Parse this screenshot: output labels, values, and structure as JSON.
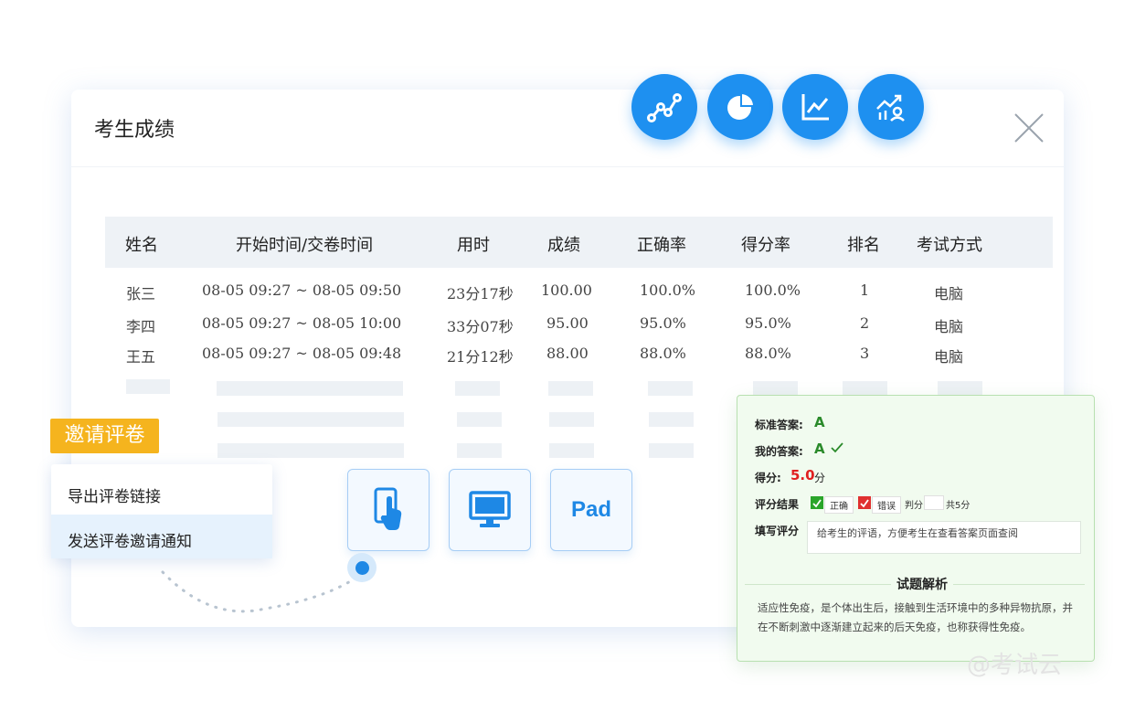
{
  "dialog": {
    "title": "考生成绩"
  },
  "toolbar_icons": [
    "line-chart-icon",
    "pie-chart-icon",
    "area-chart-icon",
    "trend-analysis-icon"
  ],
  "table": {
    "headers": [
      "姓名",
      "开始时间/交卷时间",
      "用时",
      "成绩",
      "正确率",
      "得分率",
      "排名",
      "考试方式"
    ],
    "rows": [
      [
        "张三",
        "08-05 09:27 ~ 08-05 09:50",
        "23分17秒",
        "100.00",
        "100.0%",
        "100.0%",
        "1",
        "电脑"
      ],
      [
        "李四",
        "08-05 09:27 ~ 08-05 10:00",
        "33分07秒",
        "95.00",
        "95.0%",
        "95.0%",
        "2",
        "电脑"
      ],
      [
        "王五",
        "08-05 09:27 ~ 08-05 09:48",
        "21分12秒",
        "88.00",
        "88.0%",
        "88.0%",
        "3",
        "电脑"
      ]
    ]
  },
  "invite": {
    "tag": "邀请评卷",
    "menu": [
      "导出评卷链接",
      "发送评卷邀请通知"
    ]
  },
  "devices": {
    "pad_label": "Pad"
  },
  "grading": {
    "standard_answer_label": "标准答案:",
    "standard_answer": "A",
    "my_answer_label": "我的答案:",
    "my_answer": "A",
    "score_label": "得分:",
    "score": "5.0",
    "score_unit": "分",
    "result_label": "评分结果",
    "opt_correct": "正确",
    "opt_wrong": "错误",
    "judge_label": "判分",
    "total_label": "共5分",
    "comment_label": "填写评分",
    "comment_placeholder": "给考生的评语，方便考生在查看答案页面查阅",
    "analysis_title": "试题解析",
    "analysis_text": "适应性免疫，是个体出生后，接触到生活环境中的多种异物抗原，并在不断刺激中逐渐建立起来的后天免疫，也称获得性免疫。"
  },
  "watermark": "@考试云",
  "colors": {
    "accent": "#1e90f0",
    "tag": "#f5b41e",
    "score_red": "#e02020",
    "answer_green": "#2a8a2a"
  }
}
